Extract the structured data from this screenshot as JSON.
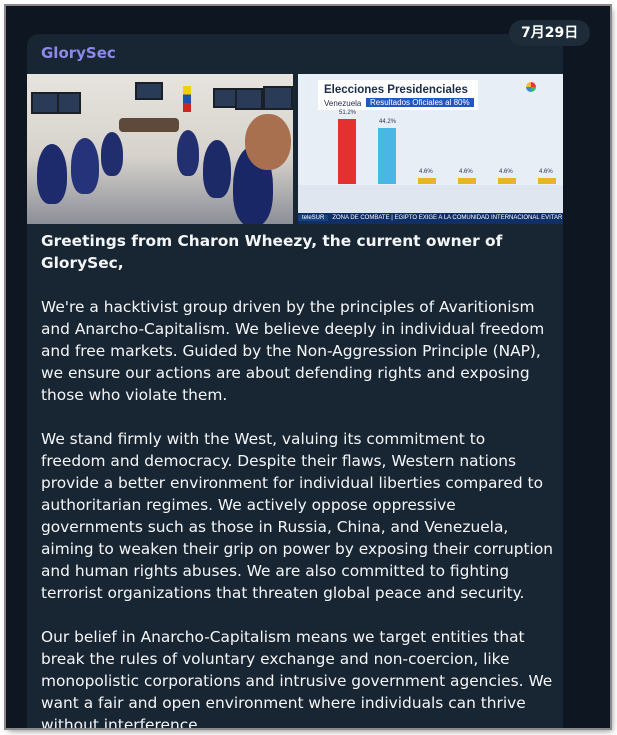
{
  "date_badge": "7月29日",
  "post": {
    "sender": "GlorySec",
    "paragraphs": [
      "Greetings from Charon Wheezy, the current owner of GlorySec,",
      "We're a hacktivist group driven by the principles of Avaritionism and Anarcho-Capitalism. We believe deeply in individual freedom and free markets. Guided by the Non-Aggression Principle (NAP), we ensure our actions are about defending rights and exposing those who violate them.",
      "We stand firmly with the West, valuing its commitment to freedom and democracy. Despite their flaws, Western nations provide a better environment for individual liberties compared to authoritarian regimes. We actively oppose oppressive governments such as those in Russia, China, and Venezuela, aiming to weaken their grip on power by exposing their corruption and human rights abuses. We are also committed to fighting terrorist organizations that threaten global peace and security.",
      "Our belief in Anarcho-Capitalism means we target entities that break the rules of voluntary exchange and non-coercion, like monopolistic corporations and intrusive government agencies. We want a fair and open environment where individuals can thrive without interference."
    ]
  },
  "tv_graphic": {
    "title": "Elecciones Presidenciales",
    "subtitle": "Venezuela",
    "badge": "Resultados Oficiales al 80%",
    "bars": [
      {
        "label": "51.2%",
        "value": 51.2,
        "color": "#e3312d"
      },
      {
        "label": "44.2%",
        "value": 44.2,
        "color": "#49b6e6"
      },
      {
        "label": "4.6%",
        "value": 4.6,
        "color": "#f0b127"
      },
      {
        "label": "4.6%",
        "value": 4.6,
        "color": "#f0b127"
      },
      {
        "label": "4.6%",
        "value": 4.6,
        "color": "#f0b127"
      },
      {
        "label": "4.6%",
        "value": 4.6,
        "color": "#f0b127"
      }
    ],
    "ticker_logo": "teleSUR",
    "ticker_text": "ZONA DE COMBATE | EGIPTO EXIGE A LA COMUNIDAD INTERNACIONAL EVITAR"
  },
  "colors": {
    "background": "#0e1621",
    "bubble": "#182533",
    "sender": "#8e88e8",
    "text": "#f5f6f8"
  }
}
